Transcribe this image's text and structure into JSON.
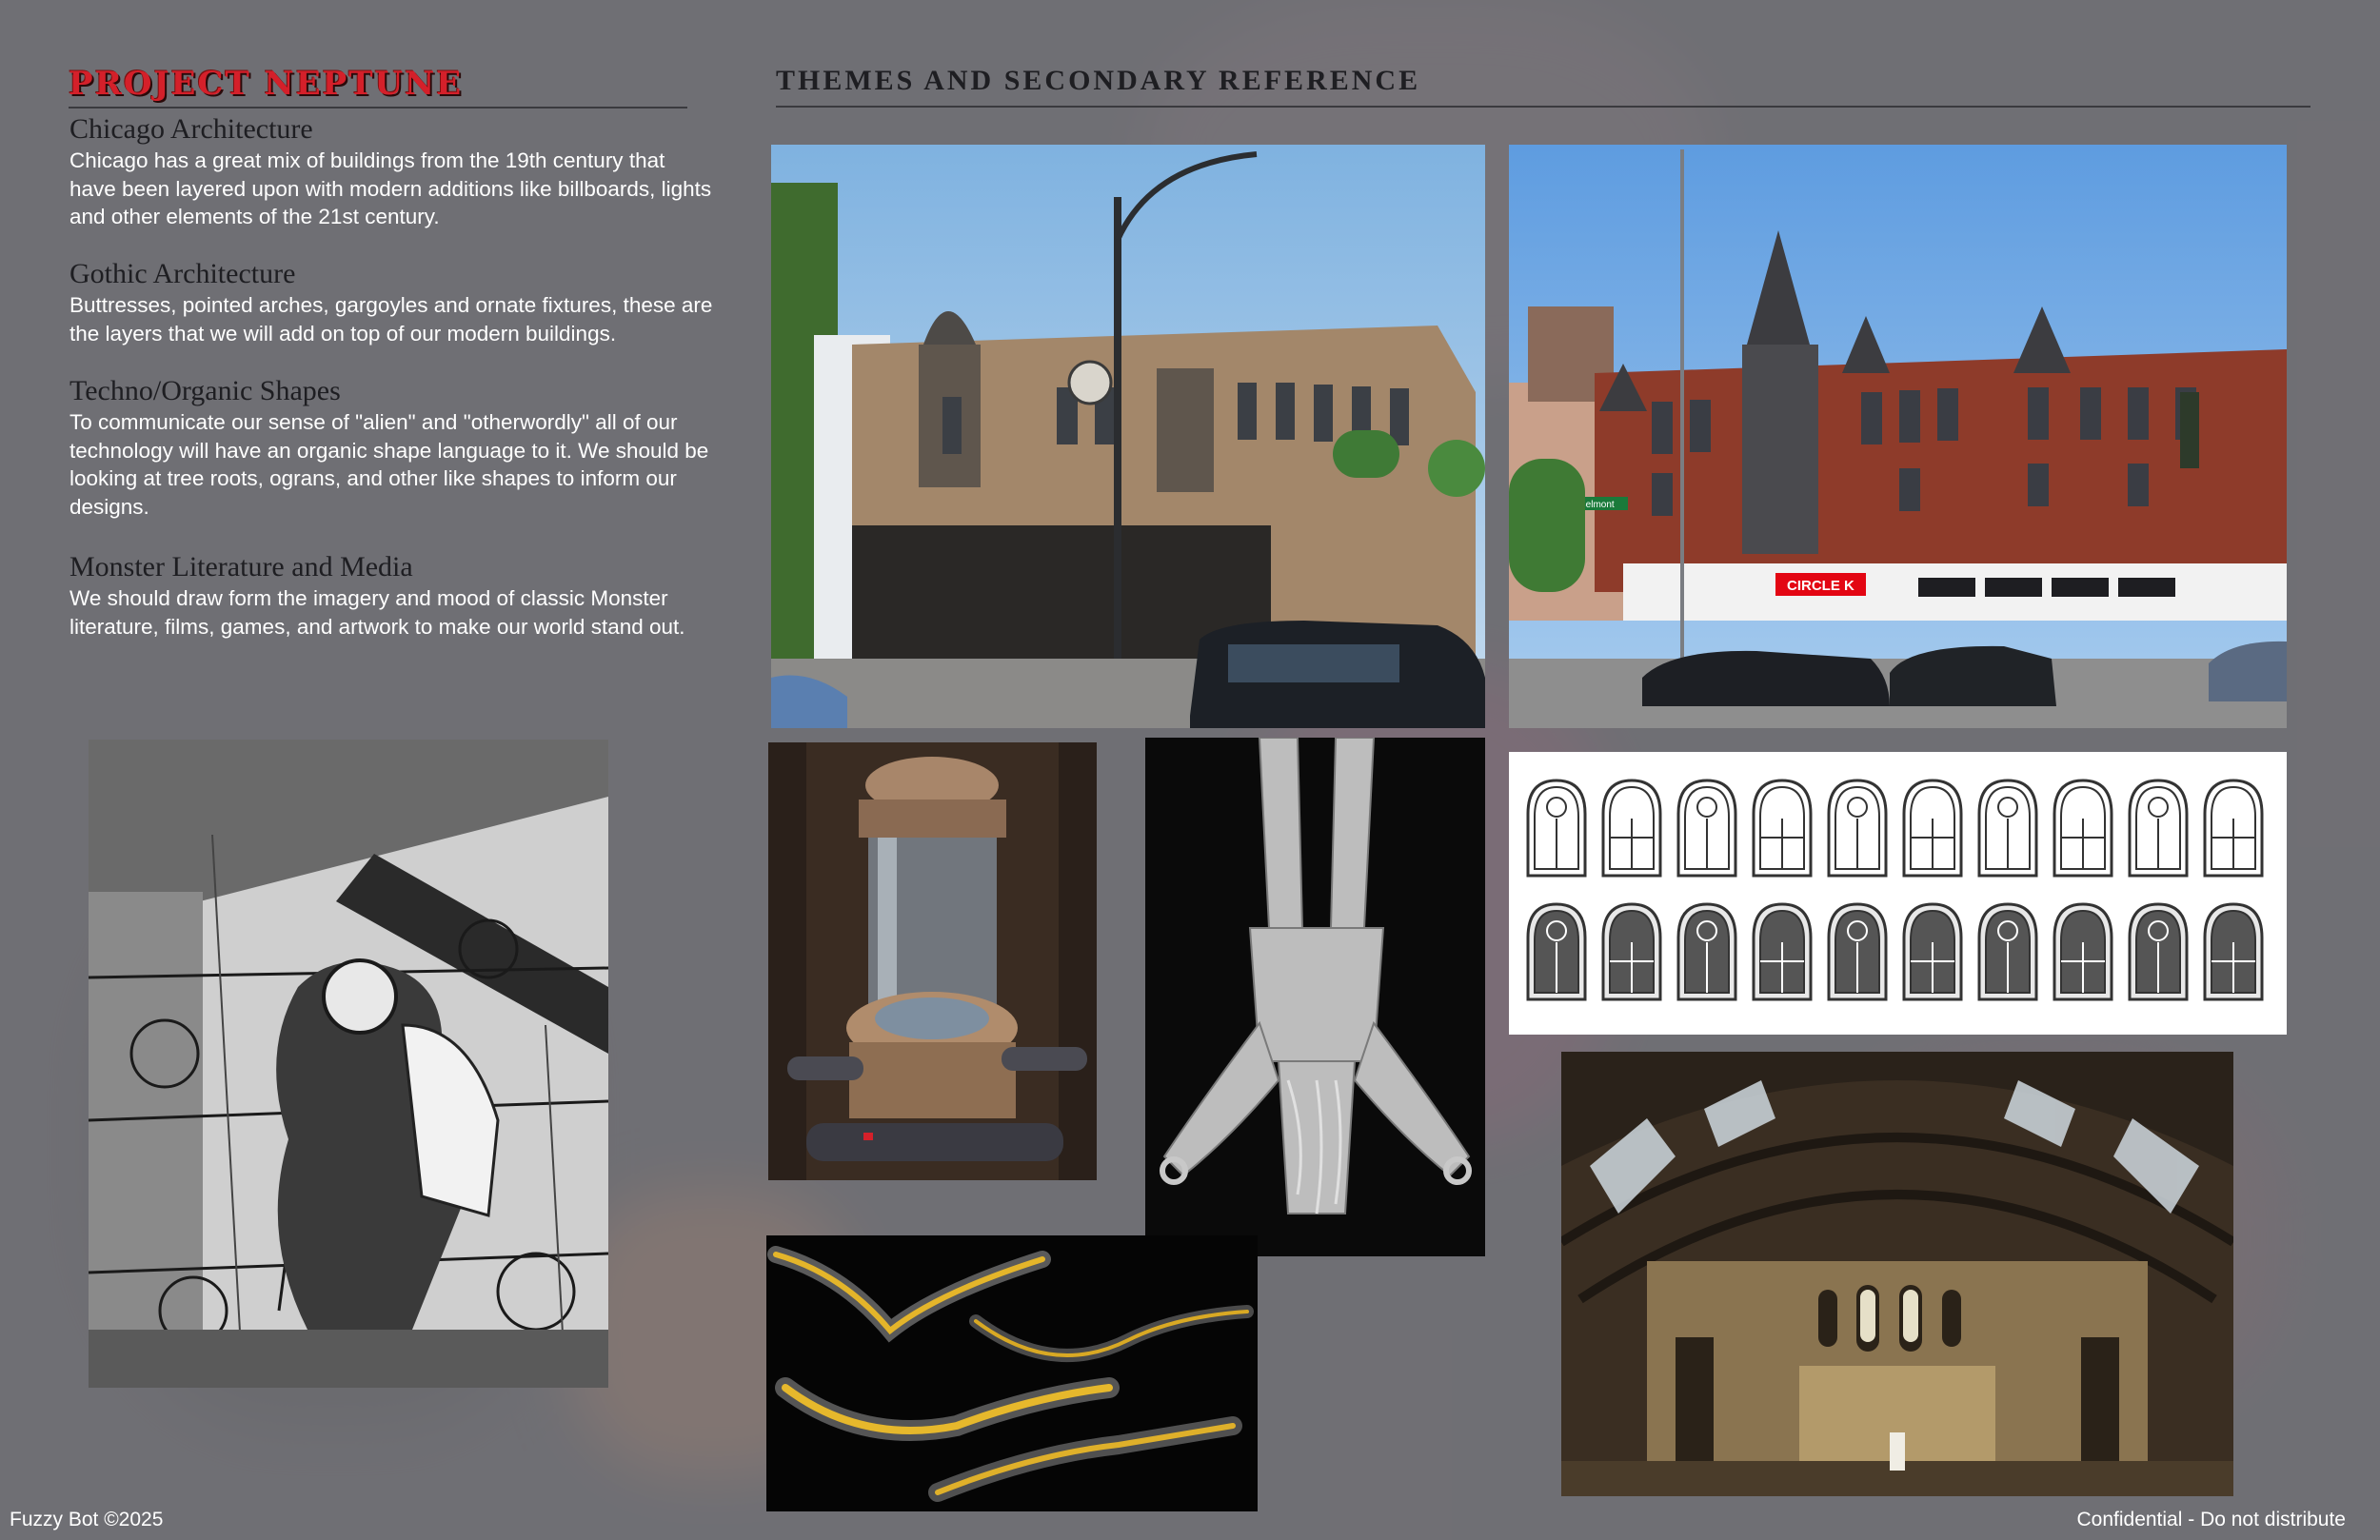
{
  "header": {
    "logo_text": "PROJECT NEPTUNE",
    "title": "THEMES AND SECONDARY REFERENCE"
  },
  "sections": [
    {
      "heading": "Chicago Architecture",
      "body": "Chicago has a great mix of buildings from the 19th century that have been layered upon with modern additions like billboards, lights and other elements of the 21st century."
    },
    {
      "heading": "Gothic Architecture",
      "body": "Buttresses, pointed arches, gargoyles and ornate fixtures, these are the layers that we will add on top of our modern buildings."
    },
    {
      "heading": "Techno/Organic Shapes",
      "body": "To communicate our sense of \"alien\" and \"otherwordly\" all of our technology will have an organic shape language to it. We should be looking at tree roots, ograns, and other like shapes to inform our designs."
    },
    {
      "heading": "Monster Literature and Media",
      "body": "We should draw form the imagery and mood of classic Monster literature, films, games, and artwork to make our world stand out."
    }
  ],
  "images": {
    "storefront_sign": "CIRCLE K",
    "street_sign": "Belmont"
  },
  "footer": {
    "left": "Fuzzy Bot ©2025",
    "right": "Confidential - Do not distribute"
  },
  "colors": {
    "background": "#6e6d72",
    "logo_red": "#d4202a",
    "heading_dark": "#1e1e22"
  }
}
